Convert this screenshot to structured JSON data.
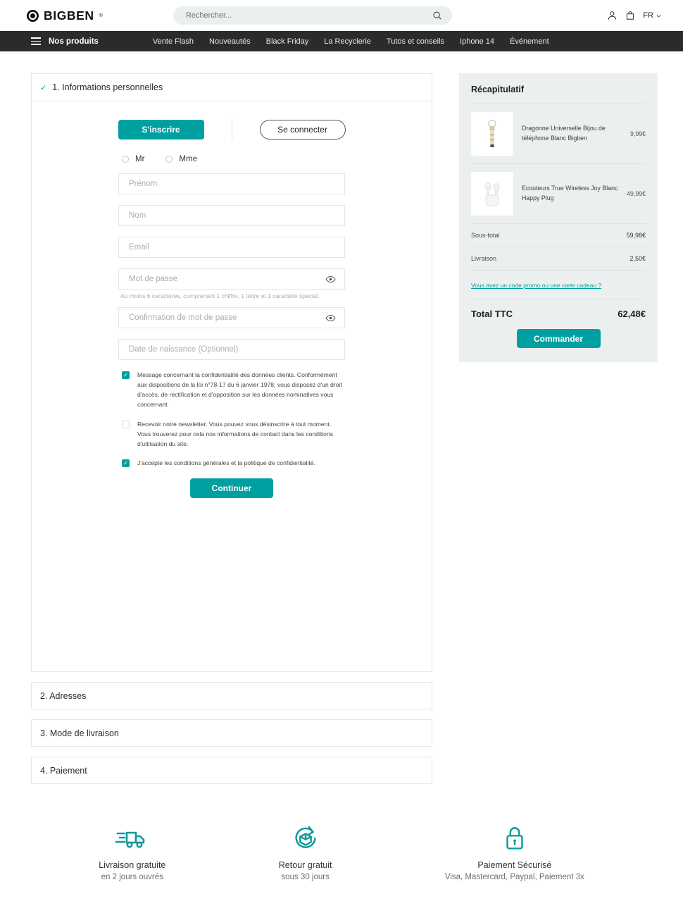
{
  "header": {
    "brand": "BIGBEN",
    "brand_tm": "®",
    "search_placeholder": "Rechercher...",
    "search_value": "",
    "language": "FR"
  },
  "nav": {
    "products_label": "Nos produits",
    "links": [
      "Vente Flash",
      "Nouveautés",
      "Black Friday",
      "La Recyclerie",
      "Tutos et conseils",
      "Iphone 14",
      "Événement"
    ]
  },
  "steps": [
    {
      "title": "1. Informations personnelles",
      "completed_mark": "✓"
    },
    {
      "title": "2. Adresses"
    },
    {
      "title": "3. Mode de livraison"
    },
    {
      "title": "4. Paiement"
    }
  ],
  "auth": {
    "signup_label": "S'inscrire",
    "login_label": "Se connecter"
  },
  "form": {
    "civility": [
      {
        "label": "Mr",
        "checked": false
      },
      {
        "label": "Mme",
        "checked": false
      }
    ],
    "fields": [
      {
        "name": "firstname",
        "placeholder": "Prénom",
        "value": ""
      },
      {
        "name": "lastname",
        "placeholder": "Nom",
        "value": ""
      },
      {
        "name": "email",
        "placeholder": "Email",
        "value": ""
      },
      {
        "name": "password",
        "placeholder": "Mot de passe",
        "value": ""
      },
      {
        "name": "password_confirm",
        "placeholder": "Confirmation de mot de passe",
        "value": ""
      },
      {
        "name": "birthdate",
        "placeholder": "Date de naissance (Optionnel)",
        "value": ""
      }
    ],
    "password_hint": "Au moins 6 caractères, comprenant 1 chiffre, 1 lettre et 1 caractère spécial.",
    "consents": [
      {
        "checked": true,
        "text": "Message concernant la confidentialité des données clients. Conformément aux dispositions de la loi n°78-17 du 6 janvier 1978, vous disposez d'un droit d'accès, de rectification et d'opposition sur les données nominatives vous concernant."
      },
      {
        "checked": false,
        "text": "Recevoir notre newsletter. Vous pouvez vous désinscrire à tout moment. Vous trouverez pour cela nos informations de contact dans les conditions d'utilisation du site."
      },
      {
        "checked": true,
        "text": "J'accepte les conditions générales et la politique de confidentialité."
      }
    ],
    "continue_label": "Continuer"
  },
  "summary": {
    "title": "Récapitulatif",
    "items": [
      {
        "name": "Dragonne Universelle Bijou de téléphone Blanc Bigben",
        "price": "9,99€",
        "thumb": "lanyard-strap"
      },
      {
        "name": "Ecouteurs True Wireless Joy Blanc Happy Plug",
        "price": "49,99€",
        "thumb": "wireless-earbuds"
      }
    ],
    "subtotal_label": "Sous-total",
    "subtotal_value": "59,98€",
    "shipping_label": "Livraison",
    "shipping_value": "2,50€",
    "promo_link": "Vous avez un code promo ou une carte cadeau ?",
    "total_label": "Total TTC",
    "total_value": "62,48€",
    "order_label": "Commander"
  },
  "footer_badges": [
    {
      "icon": "delivery-truck-icon",
      "title": "Livraison gratuite",
      "sub": "en 2 jours ouvrés"
    },
    {
      "icon": "return-box-icon",
      "title": "Retour gratuit",
      "sub": "sous 30 jours"
    },
    {
      "icon": "lock-icon",
      "title": "Paiement Sécurisé",
      "sub": "Visa, Mastercard, Paypal, Paiement 3x"
    }
  ],
  "colors": {
    "accent": "#00a0a0",
    "navbar": "#2b2b2b",
    "panel_bg": "#eceff0"
  }
}
